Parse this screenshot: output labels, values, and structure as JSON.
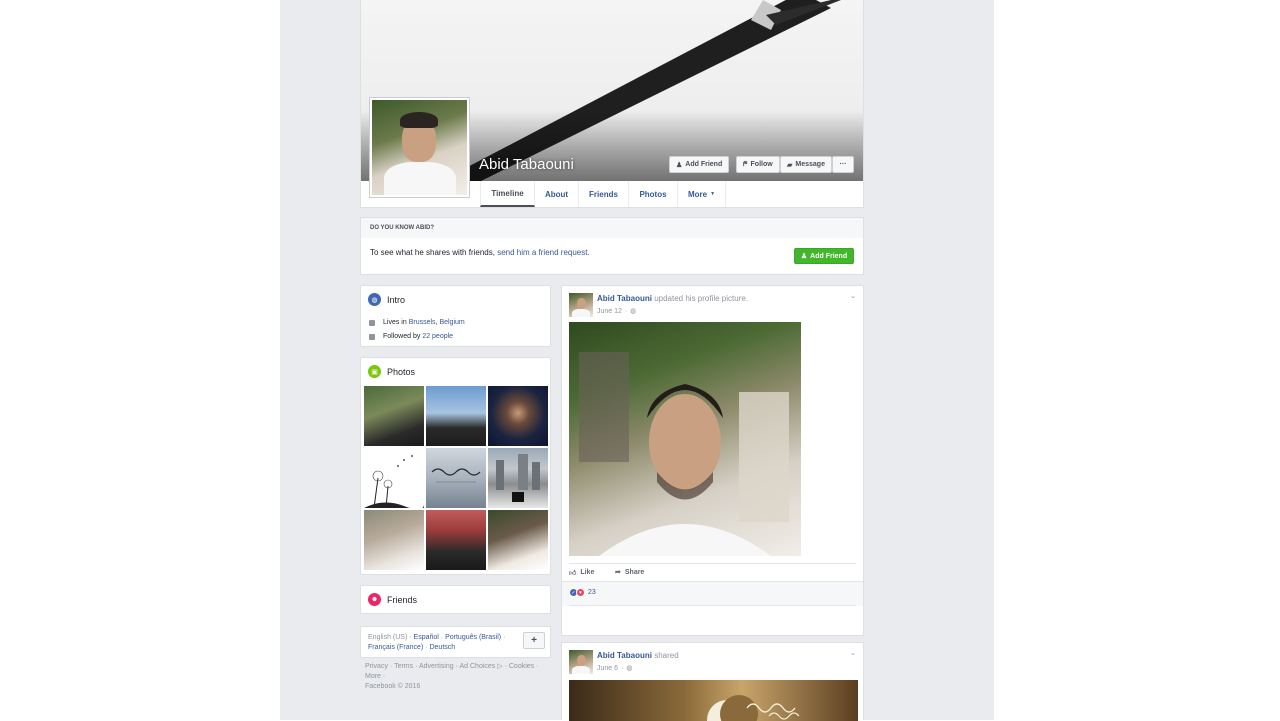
{
  "profile": {
    "name": "Abid Tabaouni"
  },
  "cover_buttons": {
    "add_friend": "Add Friend",
    "follow": "Follow",
    "message": "Message",
    "more": "···"
  },
  "nav": {
    "tabs": [
      {
        "label": "Timeline"
      },
      {
        "label": "About"
      },
      {
        "label": "Friends"
      },
      {
        "label": "Photos"
      },
      {
        "label": "More"
      }
    ],
    "more_caret": "▼"
  },
  "know": {
    "heading": "DO YOU KNOW ABID?",
    "text": "To see what he shares with friends,",
    "link": "send him a friend request.",
    "button": "Add Friend"
  },
  "intro": {
    "title": "Intro",
    "lives_prefix": "Lives in",
    "city": "Brussels",
    "comma": ",",
    "country": "Belgium",
    "followed_prefix": "Followed by",
    "followers": "22 people"
  },
  "photos": {
    "title": "Photos"
  },
  "friends": {
    "title": "Friends"
  },
  "languages": {
    "current": "English (US)",
    "others": [
      "Español",
      "Português (Brasil)",
      "Français (France)",
      "Deutsch"
    ],
    "sep": "·",
    "add": "+"
  },
  "footer": {
    "links": [
      "Privacy",
      "Terms",
      "Advertising",
      "Ad Choices",
      "Cookies",
      "More"
    ],
    "sep": "·",
    "copyright": "Facebook © 2016"
  },
  "posts": [
    {
      "author": "Abid Tabaouni",
      "action": "updated his profile picture.",
      "date": "June 12",
      "like": "Like",
      "share": "Share",
      "reactions": "23"
    },
    {
      "author": "Abid Tabaouni",
      "action": "shared",
      "date": "June 6"
    }
  ],
  "icons": {
    "add_friend": "person-plus-icon",
    "follow": "rss-icon",
    "message": "chat-bubble-icon",
    "intro": "globe-icon",
    "photos": "image-icon",
    "friends": "people-icon",
    "like": "thumbs-up-icon",
    "share": "share-arrow-icon",
    "post_menu": "chevron-down-icon",
    "privacy": "globe-small-icon"
  },
  "colors": {
    "facebook_link": "#365899",
    "green_button": "#42b72a",
    "page_bg": "#e9ebee"
  }
}
